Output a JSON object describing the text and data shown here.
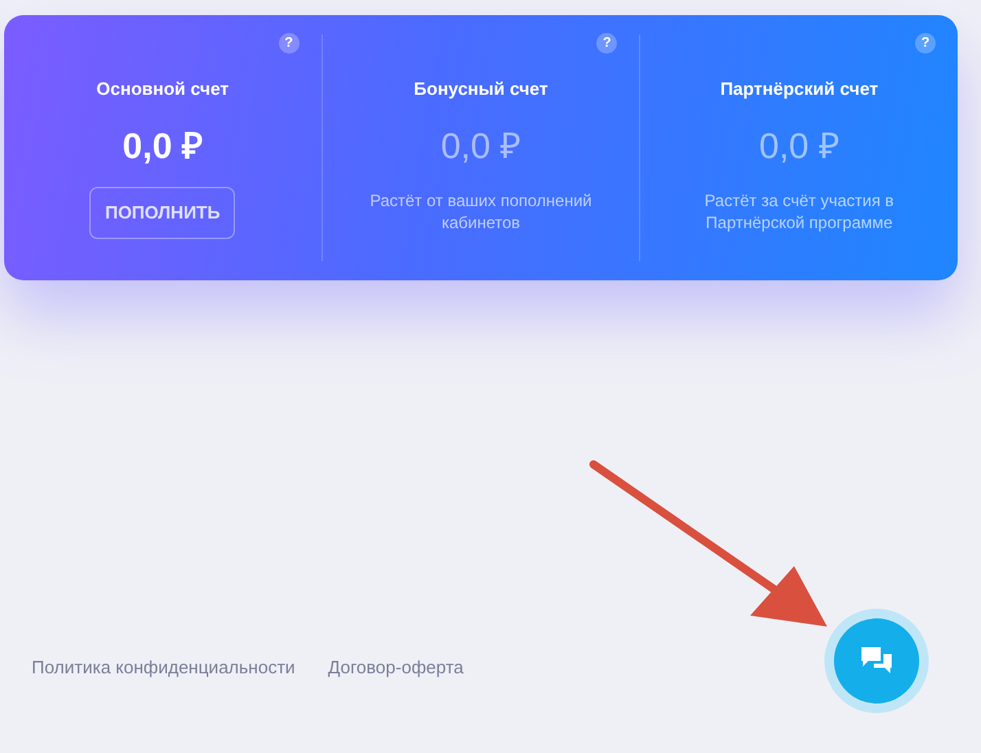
{
  "accounts": [
    {
      "kind": "main",
      "help": "?",
      "title": "Основной счет",
      "amount": "0,0 ₽",
      "button": "ПОПОЛНИТЬ"
    },
    {
      "kind": "info",
      "help": "?",
      "title": "Бонусный счет",
      "amount": "0,0 ₽",
      "description": "Растёт от ваших пополнений кабинетов"
    },
    {
      "kind": "info",
      "help": "?",
      "title": "Партнёрский счет",
      "amount": "0,0 ₽",
      "description": "Растёт за счёт участия в Партнёрской программе"
    }
  ],
  "footer": {
    "links": [
      "Политика конфиденциальности",
      "Договор-оферта"
    ]
  }
}
